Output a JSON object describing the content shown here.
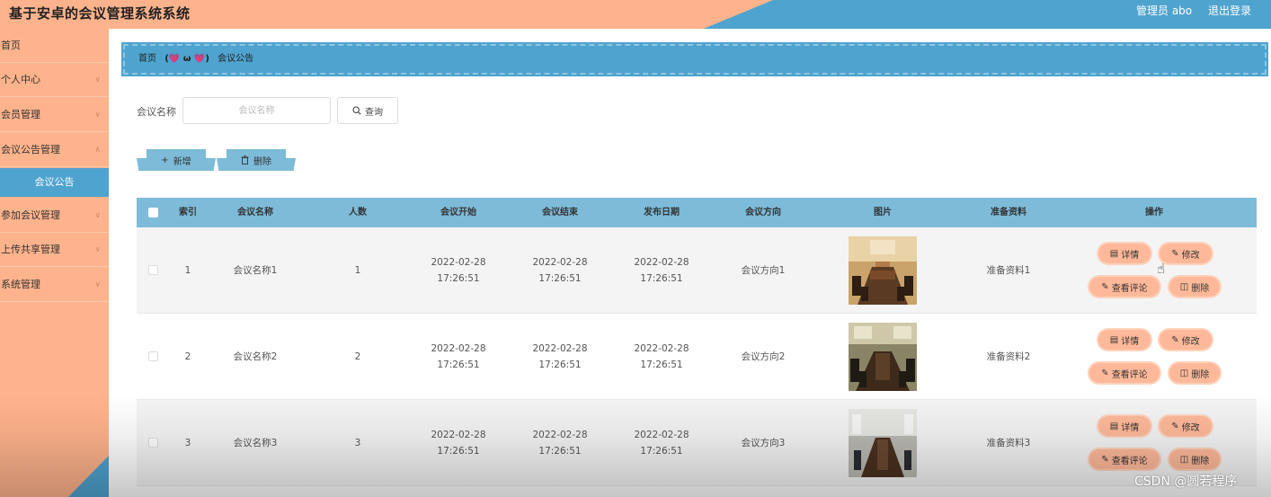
{
  "header": {
    "title": "基于安卓的会议管理系统系统",
    "admin": "管理员 abo",
    "logout": "退出登录"
  },
  "sidebar": {
    "items": [
      {
        "label": "首页",
        "has_chevron": false
      },
      {
        "label": "个人中心",
        "has_chevron": true
      },
      {
        "label": "会员管理",
        "has_chevron": true
      },
      {
        "label": "会议公告管理",
        "has_chevron": true
      },
      {
        "label": "参加会议管理",
        "has_chevron": true
      },
      {
        "label": "上传共享管理",
        "has_chevron": true
      },
      {
        "label": "系统管理",
        "has_chevron": true
      }
    ],
    "active_sub": "会议公告"
  },
  "breadcrumb": {
    "home": "首页",
    "separator": "(💗 ω 💗)",
    "current": "会议公告"
  },
  "search": {
    "label": "会议名称",
    "placeholder": "会议名称",
    "button": "查询"
  },
  "actions": {
    "add": "新增",
    "delete": "删除"
  },
  "table": {
    "headers": [
      "索引",
      "会议名称",
      "人数",
      "会议开始",
      "会议结束",
      "发布日期",
      "会议方向",
      "图片",
      "准备资料",
      "操作"
    ],
    "rows": [
      {
        "index": "1",
        "name": "会议名称1",
        "count": "1",
        "start": "2022-02-28 17:26:51",
        "end": "2022-02-28 17:26:51",
        "published": "2022-02-28 17:26:51",
        "direction": "会议方向1",
        "material": "准备资料1"
      },
      {
        "index": "2",
        "name": "会议名称2",
        "count": "2",
        "start": "2022-02-28 17:26:51",
        "end": "2022-02-28 17:26:51",
        "published": "2022-02-28 17:26:51",
        "direction": "会议方向2",
        "material": "准备资料2"
      },
      {
        "index": "3",
        "name": "会议名称3",
        "count": "3",
        "start": "2022-02-28 17:26:51",
        "end": "2022-02-28 17:26:51",
        "published": "2022-02-28 17:26:51",
        "direction": "会议方向3",
        "material": "准备资料3"
      }
    ],
    "row_buttons": {
      "detail": "详情",
      "edit": "修改",
      "comment": "查看评论",
      "delete": "删除"
    }
  },
  "watermark": "CSDN @圆若程序",
  "colors": {
    "accent_blue": "#4fa3cf",
    "header_blue_light": "#7dbbd9",
    "peach": "#ffb38c",
    "button_peach": "#ffb99a"
  }
}
